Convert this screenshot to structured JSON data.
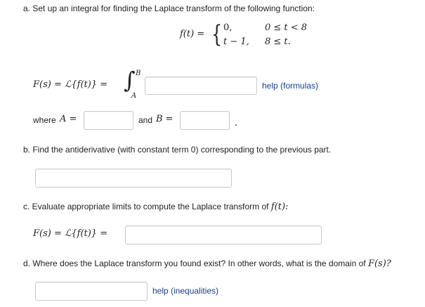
{
  "part_a": {
    "instruction": "a. Set up an integral for finding the Laplace transform of the following function:",
    "piecewise": {
      "lhs": "f(t) =",
      "cases": [
        {
          "expr": "0,",
          "condition": "0 ≤ t < 8"
        },
        {
          "expr": "t − 1,",
          "condition": "8 ≤ t."
        }
      ]
    },
    "transform_lhs": "F(s) = ℒ{f(t)} =",
    "integral_upper": "B",
    "integral_lower": "A",
    "integrand_value": "",
    "help_link": "help (formulas)",
    "where_label": "where",
    "a_label": "A =",
    "a_value": "",
    "and_label": "and",
    "b_label": "B =",
    "b_value": ""
  },
  "part_b": {
    "instruction": "b. Find the antiderivative (with constant term 0) corresponding to the previous part.",
    "value": ""
  },
  "part_c": {
    "instruction": "c. Evaluate appropriate limits to compute the Laplace transform of",
    "instruction_math": "f(t):",
    "lhs": "F(s) = ℒ{f(t)} =",
    "value": ""
  },
  "part_d": {
    "instruction": "d. Where does the Laplace transform you found exist? In other words, what is the domain of",
    "instruction_math": "F(s)?",
    "value": "",
    "help_link": "help (inequalities)"
  },
  "colors": {
    "link": "#1a3f8f",
    "input_border": "#c9c9c9",
    "text": "#222222"
  }
}
